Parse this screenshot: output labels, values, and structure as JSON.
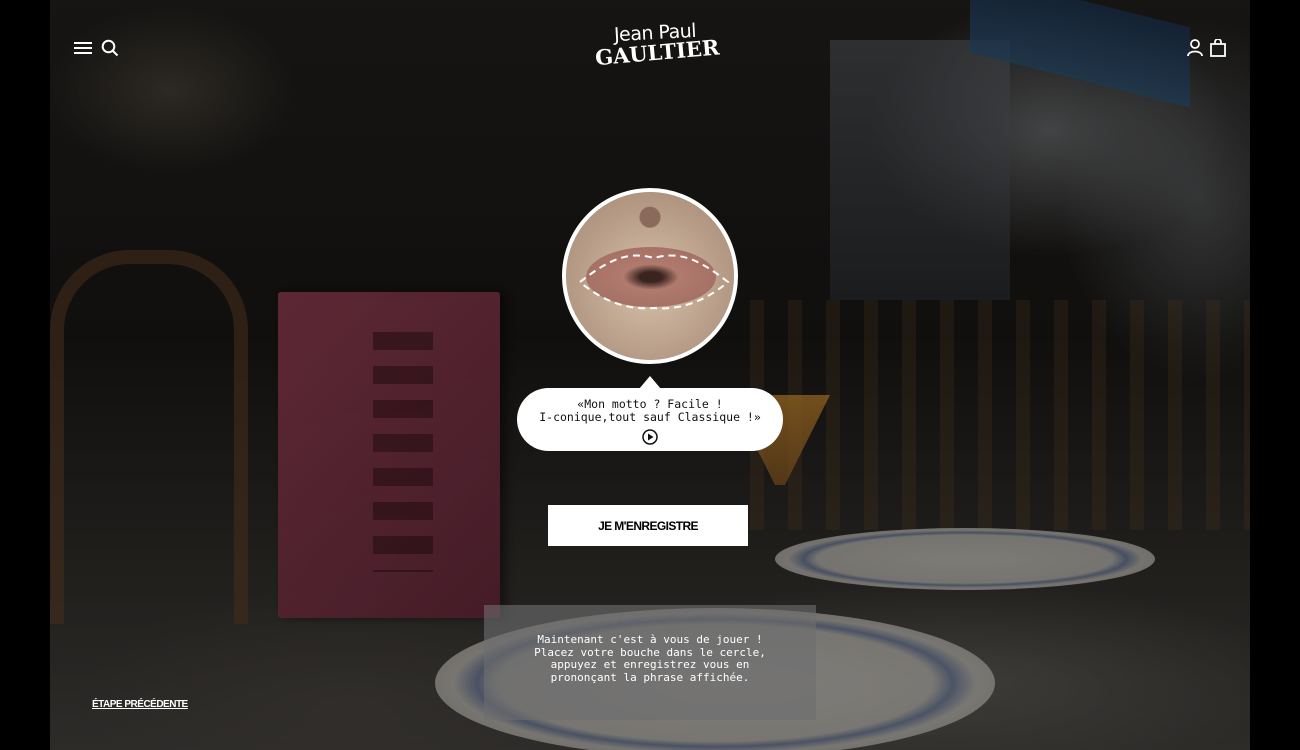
{
  "header": {
    "logo_line1": "Jean Paul",
    "logo_line2": "GAULTIER",
    "icons": [
      "menu-icon",
      "search-icon",
      "account-icon",
      "bag-icon"
    ]
  },
  "bubble": {
    "line1": "«Mon motto ? Facile !",
    "line2": "I-conique,tout sauf Classique !»",
    "play_icon": "play-icon"
  },
  "cta": {
    "label": "JE M'ENREGISTRE"
  },
  "instructions": {
    "line1": "Maintenant c'est à vous de jouer !",
    "line2": "Placez votre bouche dans le cercle,",
    "line3": "appuyez et enregistrez vous en",
    "line4": "prononçant la phrase affichée."
  },
  "footer": {
    "previous_step": "ÉTAPE PRÉCÉDENTE"
  },
  "colors": {
    "text": "#ffffff",
    "button_bg": "#ffffff",
    "panel_bg": "#6e6e70"
  }
}
